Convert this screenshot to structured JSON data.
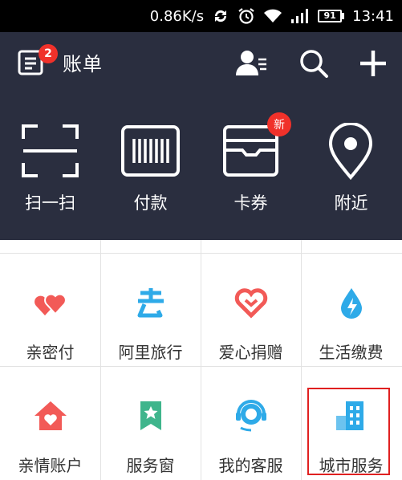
{
  "status_bar": {
    "speed": "0.86K/s",
    "battery": "91",
    "time": "13:41",
    "icons": [
      "sync-icon",
      "alarm-icon",
      "wifi-icon",
      "signal-icon",
      "battery-icon"
    ]
  },
  "header": {
    "bill_badge": "2",
    "bill_label": "账单",
    "icons": [
      "contacts-icon",
      "search-icon",
      "plus-icon"
    ]
  },
  "quick_actions": [
    {
      "label": "扫一扫",
      "icon": "scan-icon"
    },
    {
      "label": "付款",
      "icon": "barcode-icon"
    },
    {
      "label": "卡券",
      "icon": "wallet-icon",
      "badge": "新"
    },
    {
      "label": "附近",
      "icon": "location-icon"
    }
  ],
  "services": [
    {
      "label": "亲密付",
      "icon": "hearts-icon",
      "color": "#f25a57"
    },
    {
      "label": "阿里旅行",
      "icon": "travel-icon",
      "color": "#2eaae8"
    },
    {
      "label": "爱心捐赠",
      "icon": "charity-heart-icon",
      "color": "#f25a57"
    },
    {
      "label": "生活缴费",
      "icon": "water-drop-icon",
      "color": "#2eaae8"
    },
    {
      "label": "亲情账户",
      "icon": "home-heart-icon",
      "color": "#f25a57"
    },
    {
      "label": "服务窗",
      "icon": "bookmark-star-icon",
      "color": "#3fb58c"
    },
    {
      "label": "我的客服",
      "icon": "headset-icon",
      "color": "#2eaae8"
    },
    {
      "label": "城市服务",
      "icon": "city-building-icon",
      "color": "#2eaae8"
    }
  ],
  "colors": {
    "header_bg": "#2a2e3f",
    "badge_red": "#f0312a",
    "highlight_border": "#e02020"
  }
}
